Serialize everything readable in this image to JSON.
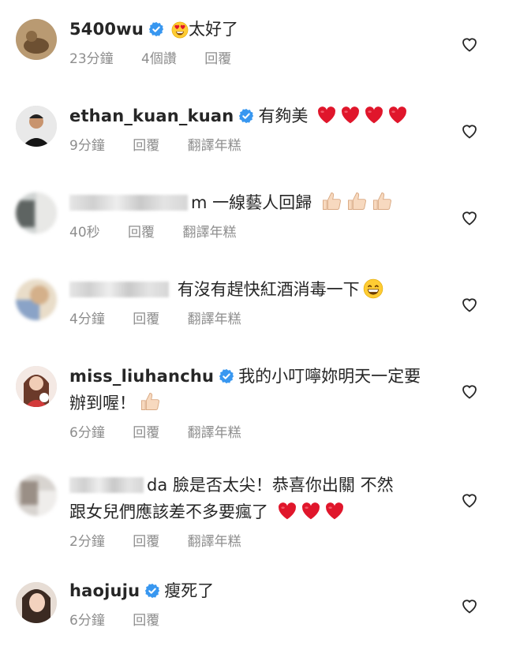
{
  "comments": [
    {
      "username": "5400wu",
      "verified": true,
      "text": "太好了",
      "emoji": "heart-eyes-face",
      "meta": [
        "23分鐘",
        "4個讚",
        "回覆"
      ]
    },
    {
      "username": "ethan_kuan_kuan",
      "verified": true,
      "text": "有夠美",
      "emoji": "red-heart x4",
      "meta": [
        "9分鐘",
        "回覆",
        "翻譯年糕"
      ]
    },
    {
      "username": "m",
      "masked": true,
      "text": "一線藝人回歸",
      "emoji": "thumbs-up x3",
      "meta": [
        "40秒",
        "回覆",
        "翻譯年糕"
      ]
    },
    {
      "username": "",
      "masked": true,
      "text": "有沒有趕快紅酒消毒一下",
      "emoji": "grinning-face",
      "meta": [
        "4分鐘",
        "回覆",
        "翻譯年糕"
      ]
    },
    {
      "username": "miss_liuhanchu",
      "verified": true,
      "text": "我的小叮嚀妳明天一定要",
      "text2": "辦到喔！",
      "emoji": "thumbs-up",
      "meta": [
        "6分鐘",
        "回覆",
        "翻譯年糕"
      ]
    },
    {
      "username": "da",
      "masked": true,
      "text": "臉是否太尖！恭喜你出關 不然",
      "text2": "跟女兒們應該差不多要瘋了",
      "emoji": "red-heart x3",
      "meta": [
        "2分鐘",
        "回覆",
        "翻譯年糕"
      ]
    },
    {
      "username": "haojuju",
      "verified": true,
      "text": "瘦死了",
      "meta": [
        "6分鐘",
        "回覆"
      ]
    }
  ],
  "colors": {
    "verified": "#3897f0",
    "meta_text": "#8e8e8e",
    "heart_emoji": "#e0162b"
  }
}
